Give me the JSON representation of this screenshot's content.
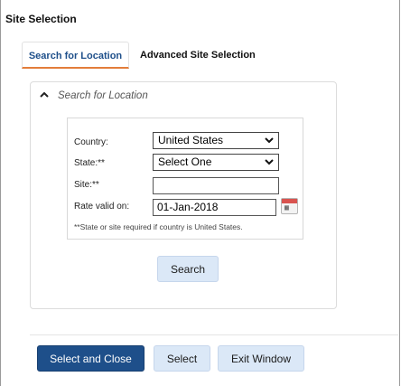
{
  "window": {
    "title": "Site Selection"
  },
  "tabs": [
    {
      "label": "Search for Location",
      "active": true
    },
    {
      "label": "Advanced Site Selection",
      "active": false
    }
  ],
  "panel": {
    "header": "Search for Location"
  },
  "form": {
    "country_label": "Country:",
    "country_value": "United States",
    "state_label": "State:**",
    "state_value": "Select One",
    "site_label": "Site:**",
    "site_value": "",
    "rate_label": "Rate valid on:",
    "rate_value": "01-Jan-2018",
    "note": "**State or site required if country is United States.",
    "search_label": "Search"
  },
  "footer": {
    "select_close_label": "Select and Close",
    "select_label": "Select",
    "exit_label": "Exit Window"
  },
  "colors": {
    "primary": "#1e4f8a",
    "tab_underline": "#e37d3a",
    "button_light": "#dbe8f7"
  },
  "icons": {
    "collapse": "chevron-up-icon",
    "calendar": "calendar-icon",
    "dropdown": "chevron-down-icon"
  }
}
